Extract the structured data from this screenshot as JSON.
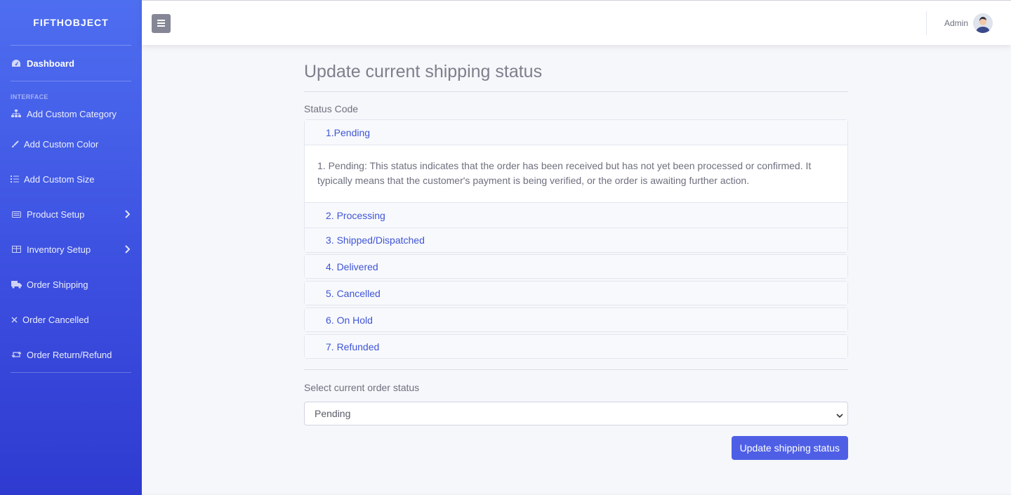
{
  "brand": "FIFTHOBJECT",
  "sidebar": {
    "dashboard": "Dashboard",
    "section_heading": "INTERFACE",
    "items": [
      {
        "label": "Add Custom Category",
        "icon": "sitemap-icon"
      },
      {
        "label": "Add Custom Color",
        "icon": "brush-icon"
      },
      {
        "label": "Add Custom Size",
        "icon": "list-icon"
      },
      {
        "label": "Product Setup",
        "icon": "barcode-icon",
        "expandable": true
      },
      {
        "label": "Inventory Setup",
        "icon": "table-icon",
        "expandable": true
      },
      {
        "label": "Order Shipping",
        "icon": "truck-icon"
      },
      {
        "label": "Order Cancelled",
        "icon": "close-icon"
      },
      {
        "label": "Order Return/Refund",
        "icon": "retweet-icon"
      }
    ]
  },
  "topbar": {
    "user_name": "Admin"
  },
  "main": {
    "title": "Update current shipping status",
    "status_code_label": "Status Code",
    "statuses": [
      {
        "label": "1.Pending",
        "description": "1. Pending: This status indicates that the order has been received but has not yet been processed or confirmed. It typically means that the customer's payment is being verified, or the order is awaiting further action."
      },
      {
        "label": "2. Processing"
      },
      {
        "label": "3. Shipped/Dispatched"
      },
      {
        "label": "4. Delivered"
      },
      {
        "label": "5. Cancelled"
      },
      {
        "label": "6. On Hold"
      },
      {
        "label": "7. Refunded"
      }
    ],
    "select_label": "Select current order status",
    "selected_status": "Pending",
    "submit_label": "Update shipping status"
  },
  "colors": {
    "sidebar_top": "#4e6ef0",
    "sidebar_bottom": "#2f3bd0",
    "accent": "#4e5fe6",
    "link": "#3f55d6"
  }
}
